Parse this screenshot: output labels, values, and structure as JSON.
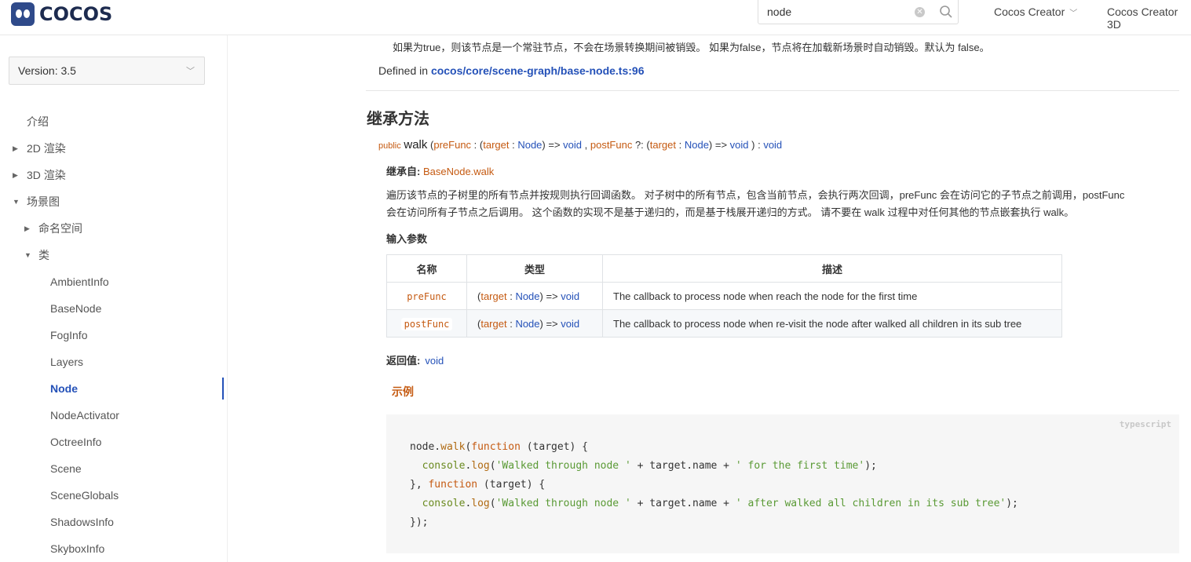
{
  "header": {
    "logo_text": "COCOS",
    "search": {
      "value": "node"
    },
    "nav": [
      {
        "label": "Cocos Creator",
        "has_dropdown": true
      },
      {
        "label": "Cocos Creator 3D"
      }
    ]
  },
  "sidebar": {
    "version_label": "Version: 3.5",
    "items": [
      {
        "label": "介绍"
      },
      {
        "label": "2D 渲染",
        "state": "collapsed"
      },
      {
        "label": "3D 渲染",
        "state": "collapsed"
      },
      {
        "label": "场景图",
        "state": "expanded"
      },
      {
        "label": "命名空间",
        "state": "collapsed"
      },
      {
        "label": "类",
        "state": "expanded"
      },
      {
        "label": "AmbientInfo"
      },
      {
        "label": "BaseNode"
      },
      {
        "label": "FogInfo"
      },
      {
        "label": "Layers"
      },
      {
        "label": "Node",
        "active": true
      },
      {
        "label": "NodeActivator"
      },
      {
        "label": "OctreeInfo"
      },
      {
        "label": "Scene"
      },
      {
        "label": "SceneGlobals"
      },
      {
        "label": "ShadowsInfo"
      },
      {
        "label": "SkyboxInfo"
      }
    ]
  },
  "main": {
    "top_desc": "如果为true，则该节点是一个常驻节点，不会在场景转换期间被销毁。 如果为false，节点将在加载新场景时自动销毁。默认为 false。",
    "defined_prefix": "Defined in ",
    "defined_link": "cocos/core/scene-graph/base-node.ts:96",
    "section_title": "继承方法",
    "signature": {
      "modifier": "public",
      "name": "walk",
      "p1": "preFunc",
      "p2": "postFunc",
      "target": "target",
      "node": "Node",
      "void": "void"
    },
    "inherit_label": "继承自:",
    "inherit_link": "BaseNode.walk",
    "description_line1": "遍历该节点的子树里的所有节点并按规则执行回调函数。 对子树中的所有节点，包含当前节点，会执行两次回调，preFunc 会在访问它的子节点之前调用，postFunc",
    "description_line2": "会在访问所有子节点之后调用。 这个函数的实现不是基于递归的，而是基于栈展开递归的方式。 请不要在 walk 过程中对任何其他的节点嵌套执行 walk。",
    "params_title": "输入参数",
    "params_headers": [
      "名称",
      "类型",
      "描述"
    ],
    "params": [
      {
        "name": "preFunc",
        "type_target": "target",
        "type_node": "Node",
        "type_void": "void",
        "desc": "The callback to process node when reach the node for the first time"
      },
      {
        "name": "postFunc",
        "type_target": "target",
        "type_node": "Node",
        "type_void": "void",
        "desc": "The callback to process node when re-visit the node after walked all children in its sub tree"
      }
    ],
    "returns_label": "返回值:",
    "returns_value": "void",
    "example_title": "示例",
    "code_lang": "typescript",
    "code": {
      "str1": "'Walked through node '",
      "str2": "' for the first time'",
      "str3": "' after walked all children in its sub tree'"
    }
  }
}
